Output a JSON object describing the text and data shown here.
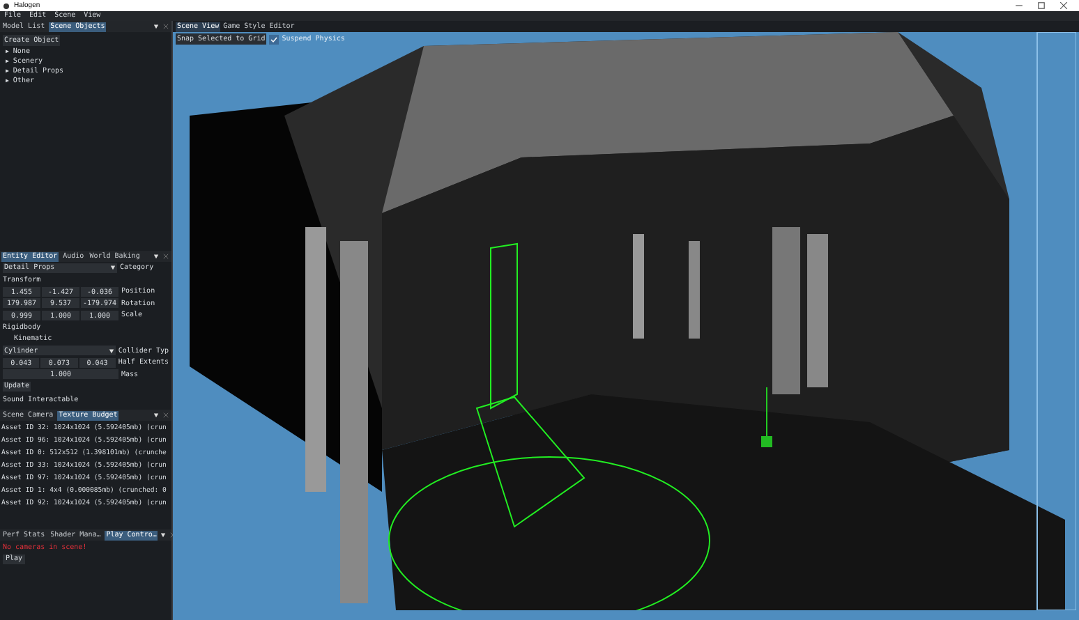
{
  "window": {
    "title": "Halogen"
  },
  "menu": [
    "File",
    "Edit",
    "Scene",
    "View"
  ],
  "objects_panel": {
    "tabs": [
      {
        "label": "Model List",
        "selected": false
      },
      {
        "label": "Scene Objects",
        "selected": true
      }
    ],
    "create_button": "Create Object",
    "tree": [
      {
        "label": "None",
        "arrow": "▶"
      },
      {
        "label": "Scenery",
        "arrow": "▶"
      },
      {
        "label": "Detail Props",
        "arrow": "▶"
      },
      {
        "label": "Other",
        "arrow": "▶"
      }
    ]
  },
  "entity_panel": {
    "tabs": [
      {
        "label": "Entity Editor",
        "selected": true
      },
      {
        "label": "Audio",
        "selected": false
      },
      {
        "label": "World Baking",
        "selected": false
      }
    ],
    "category": {
      "value": "Detail Props",
      "label": "Category"
    },
    "transform_heading": "Transform",
    "transform_rows": [
      {
        "values": [
          "1.455",
          "-1.427",
          "-0.036"
        ],
        "label": "Position"
      },
      {
        "values": [
          "179.987",
          "9.537",
          "-179.974"
        ],
        "label": "Rotation"
      },
      {
        "values": [
          "0.999",
          "1.000",
          "1.000"
        ],
        "label": "Scale"
      }
    ],
    "rigidbody_heading": "Rigidbody",
    "kinematic": "Kinematic",
    "collider": {
      "value": "Cylinder",
      "label": "Collider Typ"
    },
    "half_extents": {
      "values": [
        "0.043",
        "0.073",
        "0.043"
      ],
      "label": "Half Extents"
    },
    "mass": {
      "value": "1.000",
      "label": "Mass"
    },
    "update_button": "Update",
    "sound_label": "Sound Interactable"
  },
  "budget_panel": {
    "tabs": [
      {
        "label": "Scene Camera",
        "selected": false
      },
      {
        "label": "Texture Budget",
        "selected": true
      }
    ],
    "rows": [
      "Asset ID 32: 1024x1024 (5.592405mb) (crun",
      "Asset ID 96: 1024x1024 (5.592405mb) (crun",
      "Asset ID 0: 512x512 (1.398101mb) (crunche",
      "Asset ID 33: 1024x1024 (5.592405mb) (crun",
      "Asset ID 97: 1024x1024 (5.592405mb) (crun",
      "Asset ID 1: 4x4 (0.000085mb) (crunched: 0",
      "Asset ID 92: 1024x1024 (5.592405mb) (crun"
    ]
  },
  "play_panel": {
    "tabs": [
      {
        "label": "Perf Stats",
        "selected": false
      },
      {
        "label": "Shader Mana…",
        "selected": false
      },
      {
        "label": "Play Contro…",
        "selected": true
      }
    ],
    "error": "No cameras in scene!",
    "play_button": "Play"
  },
  "viewport": {
    "tabs": [
      {
        "label": "Scene View",
        "selected": true
      },
      {
        "label": "Game",
        "selected": false
      },
      {
        "label": "Style Editor",
        "selected": false
      }
    ],
    "snap_button": "Snap Selected to Grid",
    "suspend_physics": {
      "label": "Suspend Physics",
      "checked": true
    }
  }
}
